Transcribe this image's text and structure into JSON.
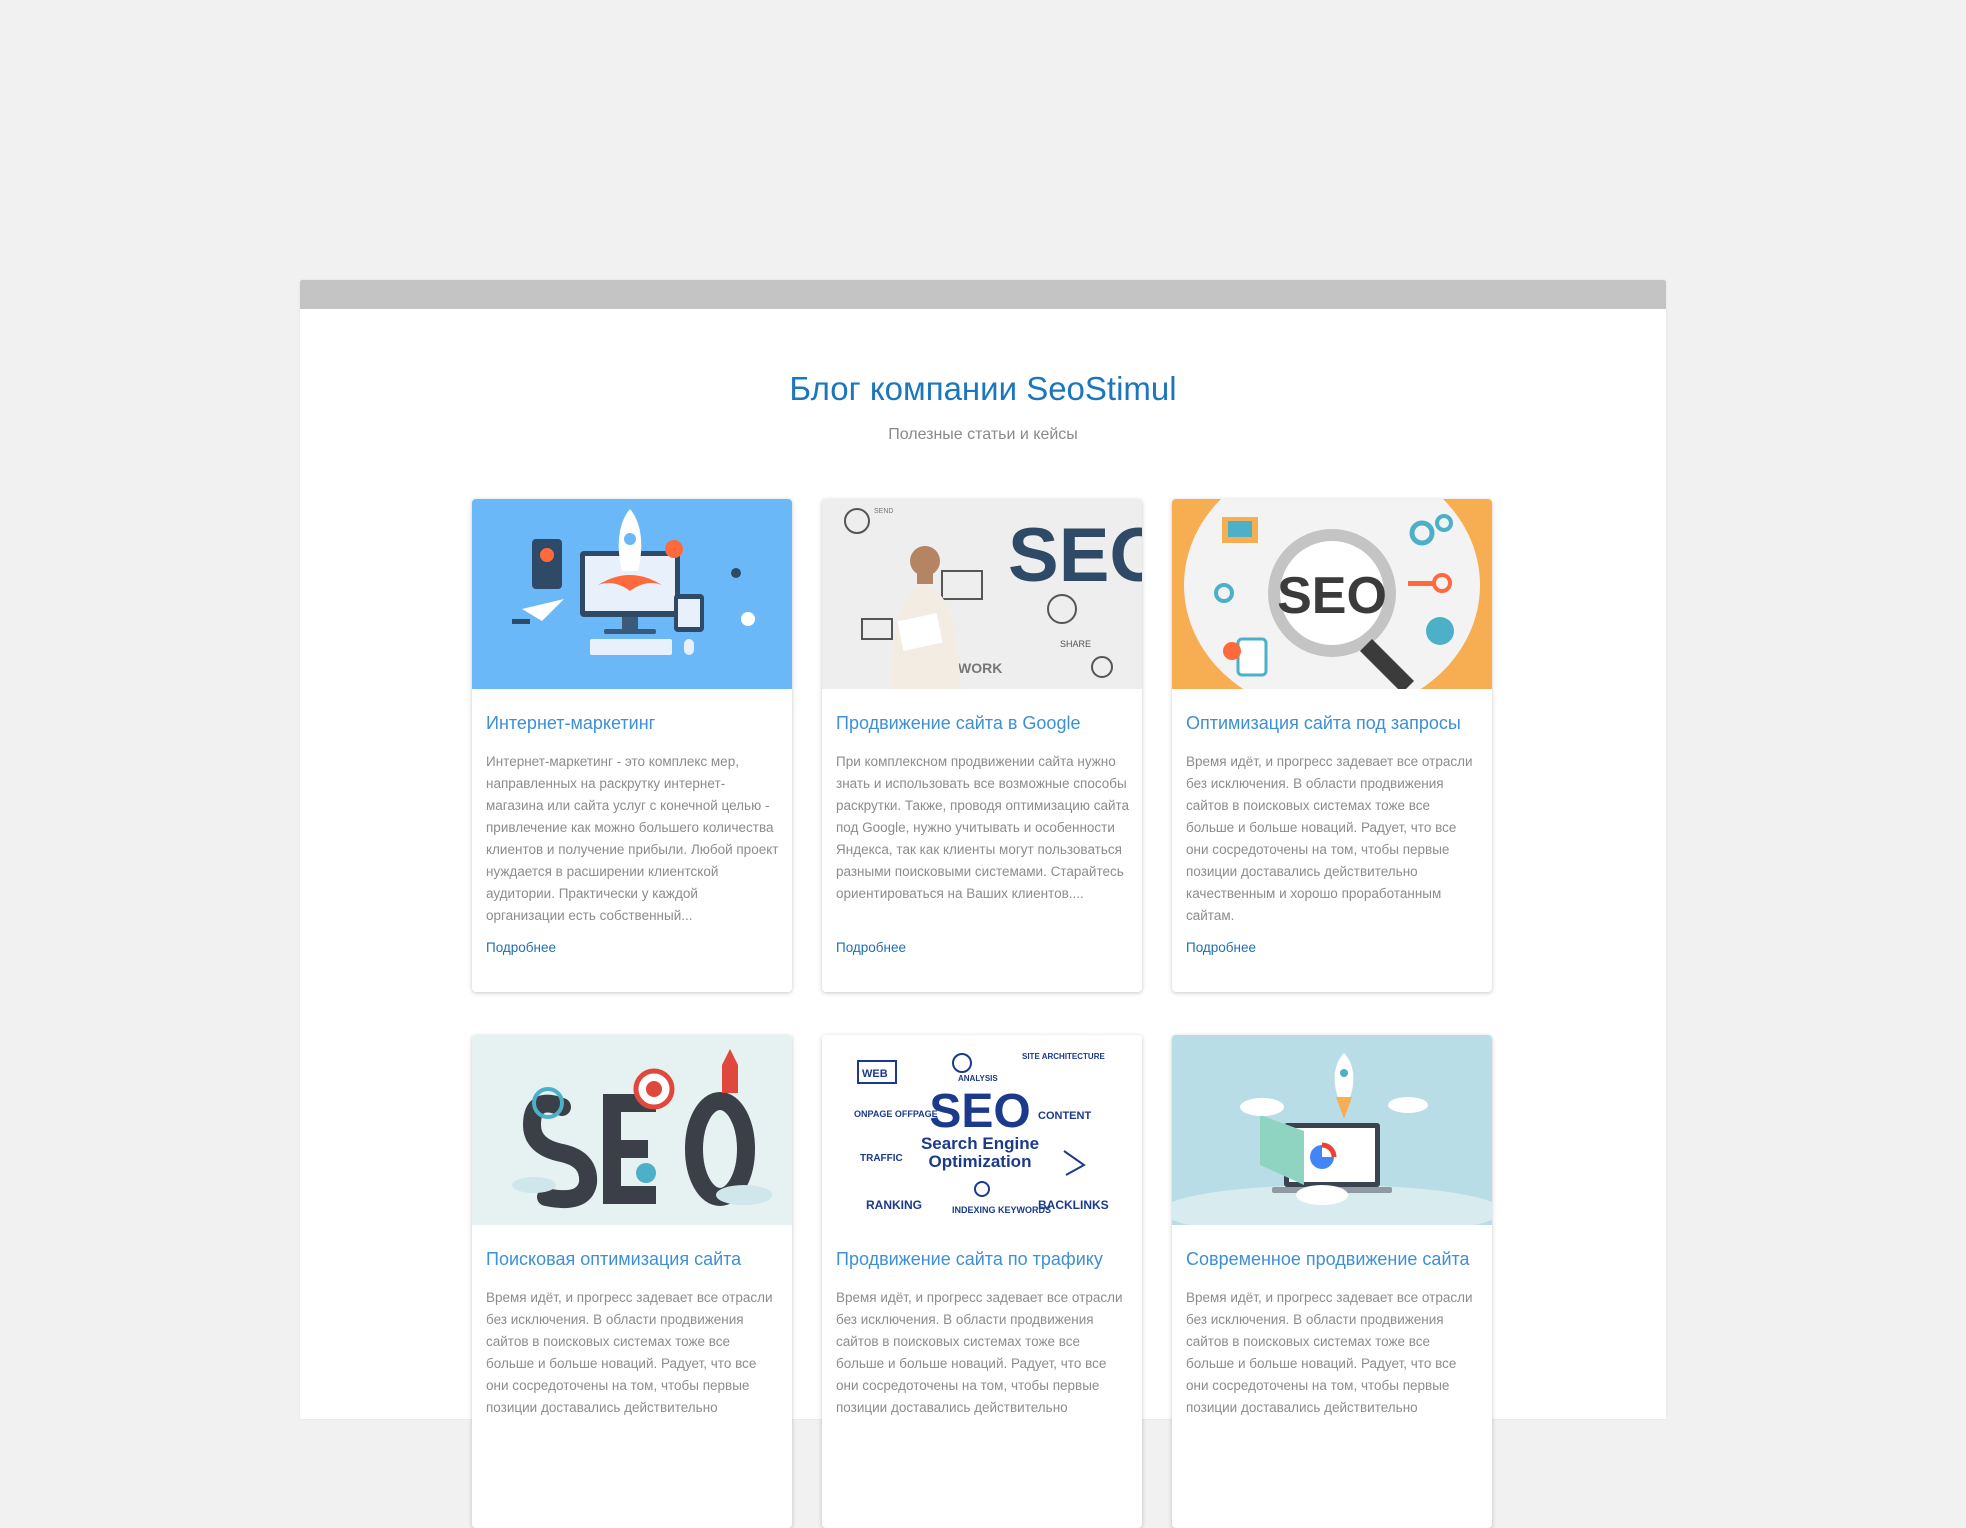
{
  "header": {
    "title": "Блог компании SeoStimul",
    "subtitle": "Полезные статьи и кейсы"
  },
  "more_label": "Подробнее",
  "cards": [
    {
      "title": "Интернет-маркетинг",
      "text": "Интернет-маркетинг - это комплекс мер, направленных на раскрутку интернет-магазина или сайта услуг с конечной целью - привлечение как можно большего количества клиентов и получение прибыли. Любой проект нуждается в расширении клиентской аудитории. Практически у каждой организации есть собственный...",
      "image": "rocket-marketing-illustration",
      "image_bg": "#6ab8f7"
    },
    {
      "title": "Продвижение сайта в Google",
      "text": "При комплексном продвижении сайта нужно знать и использовать все возможные способы раскрутки. Также, проводя оптимизацию сайта под Google, нужно учитывать и особенности Яндекса, так как клиенты могут пользоваться разными поисковыми системами. Старайтесь ориентироваться на Ваших клиентов....",
      "image": "man-with-seo-doodles-photo",
      "image_bg": "#eeeeee",
      "image_text": [
        "SEO",
        "SHARE",
        "NETWORK",
        "SEND"
      ]
    },
    {
      "title": "Оптимизация сайта под запросы",
      "text": "Время идёт, и прогресс задевает все отрасли без исключения. В области продвижения сайтов в поисковых системах тоже все больше и больше новаций. Радует, что все они сосредоточены на том, чтобы первые позиции доставались действительно качественным и хорошо проработанным сайтам.",
      "image": "seo-magnifier-illustration",
      "image_bg": "#f7ae52",
      "image_text": [
        "SEO"
      ]
    },
    {
      "title": "Поисковая оптимизация сайта",
      "text": "Время идёт, и прогресс задевает все отрасли без исключения. В области продвижения сайтов в поисковых системах тоже все больше и больше новаций. Радует, что все они сосредоточены на том, чтобы первые позиции доставались действительно",
      "image": "seo-letters-road-illustration",
      "image_bg": "#e6f1f1"
    },
    {
      "title": "Продвижение сайта по трафику",
      "text": "Время идёт, и прогресс задевает все отрасли без исключения. В области продвижения сайтов в поисковых системах тоже все больше и больше новаций. Радует, что все они сосредоточены на том, чтобы первые позиции доставались действительно",
      "image": "seo-doodle-words-illustration",
      "image_bg": "#ffffff",
      "image_text": [
        "SEO",
        "Search Engine",
        "Optimization",
        "WEB",
        "ANALYSIS",
        "SITE ARCHITECTURE",
        "ONPAGE OFFPAGE",
        "CONTENT",
        "TRAFFIC",
        "RANKING",
        "INDEXING KEYWORDS",
        "BACKLINKS"
      ]
    },
    {
      "title": "Современное продвижение сайта",
      "text": "Время идёт, и прогресс задевает все отрасли без исключения. В области продвижения сайтов в поисковых системах тоже все больше и больше новаций. Радует, что все они сосредоточены на том, чтобы первые позиции доставались действительно",
      "image": "rocket-laptop-google-illustration",
      "image_bg": "#b9dde6"
    }
  ]
}
